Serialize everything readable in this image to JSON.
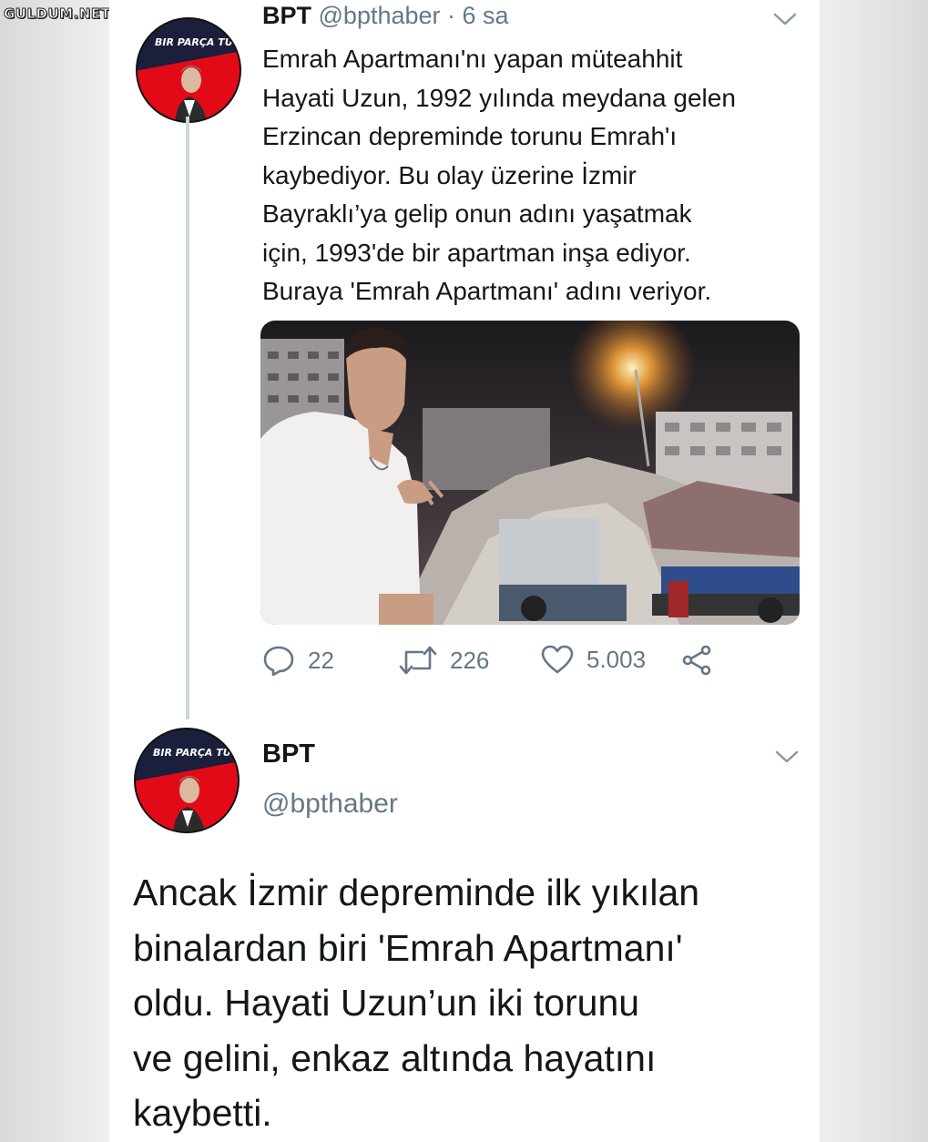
{
  "watermark": "GULDUM.NET",
  "tweet1": {
    "avatar_text": "BIR PARÇA TÜRK",
    "name": "BPT",
    "handle": "@bpthaber",
    "time": "· 6 sa",
    "text_lines": [
      "Emrah Apartmanı'nı yapan müteahhit",
      "Hayati Uzun, 1992 yılında meydana gelen",
      "Erzincan depreminde torunu Emrah'ı",
      "kaybediyor. Bu olay üzerine İzmir",
      "Bayraklı’ya gelip onun adını yaşatmak",
      "için, 1993'de bir apartman inşa ediyor.",
      "Buraya 'Emrah Apartmanı' adını veriyor."
    ],
    "actions": {
      "reply_count": "22",
      "retweet_count": "226",
      "like_count": "5.003"
    }
  },
  "tweet2": {
    "avatar_text": "BIR PARÇA TÜRK",
    "name": "BPT",
    "handle": "@bpthaber",
    "text_lines": [
      "Ancak İzmir depreminde ilk yıkılan",
      "binalardan biri 'Emrah Apartmanı'",
      "oldu. Hayati Uzun’un iki torunu",
      "ve gelini, enkaz altında hayatını",
      "kaybetti."
    ]
  },
  "colors": {
    "text": "#14171a",
    "secondary": "#657786",
    "thread_line": "#ccd6dd",
    "avatar_red": "#e30a17",
    "avatar_navy": "#1b1f3b"
  },
  "icons": [
    "chevron-down-icon",
    "reply-icon",
    "retweet-icon",
    "like-icon",
    "share-icon"
  ]
}
